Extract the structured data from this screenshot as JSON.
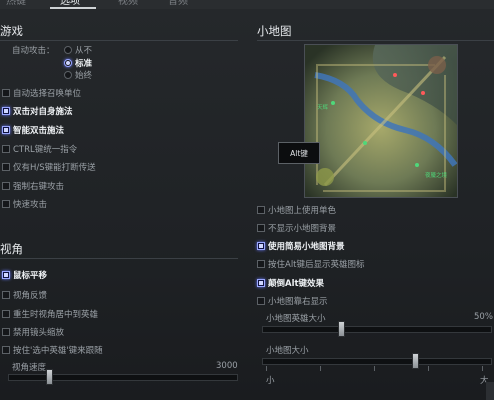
{
  "tabs": [
    "热键",
    "选项",
    "视频",
    "音频"
  ],
  "active_tab": "选项",
  "game": {
    "title": "游戏",
    "auto_attack_label": "自动攻击：",
    "auto_attack_options": [
      {
        "label": "从不",
        "selected": false
      },
      {
        "label": "标准",
        "selected": true
      },
      {
        "label": "始终",
        "selected": false
      }
    ],
    "checkboxes": [
      {
        "label": "自动选择召唤单位",
        "checked": false
      },
      {
        "label": "双击对自身施法",
        "checked": true
      },
      {
        "label": "智能双击施法",
        "checked": true
      },
      {
        "label": "CTRL键统一指令",
        "checked": false
      },
      {
        "label": "仅有H/S键能打断传送",
        "checked": false
      },
      {
        "label": "强制右键攻击",
        "checked": false
      },
      {
        "label": "快速攻击",
        "checked": false
      }
    ]
  },
  "camera": {
    "title": "视角",
    "checkboxes": [
      {
        "label": "鼠标平移",
        "checked": true
      },
      {
        "label": "视角反馈",
        "checked": false
      },
      {
        "label": "重生时视角居中到英雄",
        "checked": false
      },
      {
        "label": "禁用镜头缩放",
        "checked": false
      },
      {
        "label": "按住'选中英雄'键来跟随",
        "checked": false
      }
    ],
    "speed_label": "视角速度",
    "speed_value": "3000"
  },
  "minimap": {
    "title": "小地图",
    "alt_button": "Alt键",
    "map_labels": [
      "天辉",
      "夜魇之境"
    ],
    "checkboxes": [
      {
        "label": "小地图上使用单色",
        "checked": false
      },
      {
        "label": "不显示小地图背景",
        "checked": false
      },
      {
        "label": "使用简易小地图背景",
        "checked": true
      },
      {
        "label": "按住Alt键后显示英雄图标",
        "checked": false
      },
      {
        "label": "颠倒Alt键效果",
        "checked": true
      },
      {
        "label": "小地图靠右显示",
        "checked": false
      }
    ],
    "hero_size_label": "小地图英雄大小",
    "hero_size_value": "50%",
    "map_size_label": "小地图大小",
    "map_size_min": "小",
    "map_size_max": "大"
  },
  "colors": {
    "accent": "#9aa7ff",
    "checked_fill": "#0f1240",
    "bg": "#1c1f22"
  }
}
